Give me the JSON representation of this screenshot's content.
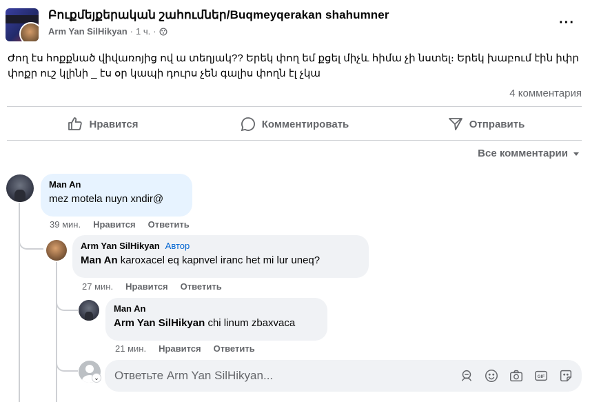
{
  "post": {
    "group_name": "Բուքմեյքերական շահումներ/Buqmeyqerakan shahumner",
    "author": "Arm Yan SilHikyan",
    "time": "1 ч.",
    "separator": "·",
    "more_label": "···",
    "text": "Ժող էս հոքքնած վիվառոյից ով ա տեղյակ?? Երեկ փող եմ քցել միչև հիմա չի նստել։ Երեկ խաբում էին իփր փոքր ուշ կլինի _ էս օր կապի դուրս չեն գալիս փողն էլ չկա",
    "comment_count": "4 комментария"
  },
  "actions": {
    "like": "Нравится",
    "comment": "Комментировать",
    "share": "Отправить"
  },
  "sort_label": "Все комментарии",
  "comments": [
    {
      "name": "Man An",
      "text": "mez motela nuyn xndir@",
      "time": "39 мин.",
      "like": "Нравится",
      "reply": "Ответить"
    },
    {
      "name": "Arm Yan SilHikyan",
      "badge": "Автор",
      "mention": "Man An",
      "text": "karoxacel eq kapnvel iranc het mi lur uneq?",
      "time": "27 мин.",
      "like": "Нравится",
      "reply": "Ответить"
    },
    {
      "name": "Man An",
      "mention": "Arm Yan SilHikyan",
      "text": "chi linum zbaxvaca",
      "time": "21 мин.",
      "like": "Нравится",
      "reply": "Ответить"
    }
  ],
  "reply_input": {
    "placeholder": "Ответьте Arm Yan SilHikyan..."
  },
  "colors": {
    "accent": "#0064d1",
    "bubble": "#f0f2f5",
    "bubble_highlight": "#e7f3ff",
    "muted": "#65676b"
  }
}
